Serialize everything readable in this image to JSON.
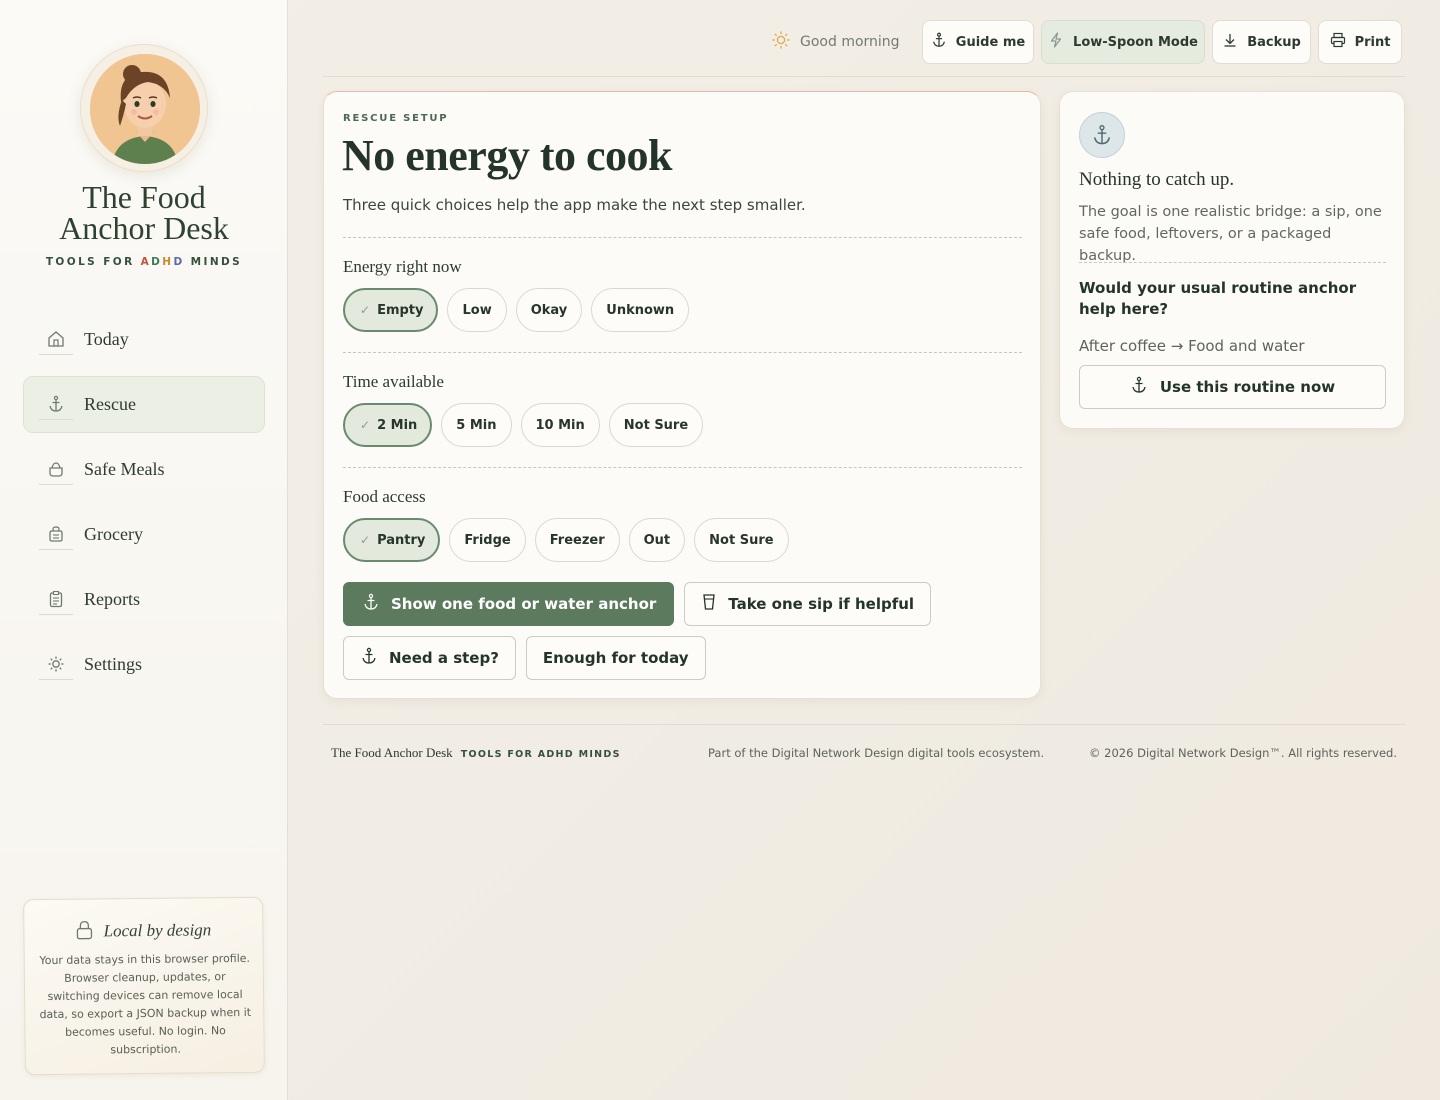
{
  "brand": {
    "title_line1": "The Food",
    "title_line2": "Anchor Desk",
    "tagline_pre": "TOOLS FOR ",
    "tagline_a": "A",
    "tagline_d1": "D",
    "tagline_h": "H",
    "tagline_d2": "D",
    "tagline_post": " MINDS"
  },
  "sidebar": {
    "items": [
      {
        "label": "Today",
        "icon": "home-icon"
      },
      {
        "label": "Rescue",
        "icon": "anchor-icon",
        "active": true
      },
      {
        "label": "Safe Meals",
        "icon": "bowl-icon"
      },
      {
        "label": "Grocery",
        "icon": "basket-icon"
      },
      {
        "label": "Reports",
        "icon": "clipboard-icon"
      },
      {
        "label": "Settings",
        "icon": "gear-icon"
      }
    ],
    "local_card": {
      "title": "Local by design",
      "body": "Your data stays in this browser profile. Browser cleanup, updates, or switching devices can remove local data, so export a JSON backup when it becomes useful. No login. No subscription."
    }
  },
  "topbar": {
    "greeting": "Good morning",
    "guide": "Guide me",
    "low_spoon": "Low-Spoon Mode",
    "backup": "Backup",
    "print": "Print"
  },
  "rescue": {
    "eyebrow": "RESCUE SETUP",
    "title": "No energy to cook",
    "subtitle": "Three quick choices help the app make the next step smaller.",
    "energy": {
      "label": "Energy right now",
      "options": [
        "Empty",
        "Low",
        "Okay",
        "Unknown"
      ],
      "selected": "Empty"
    },
    "time": {
      "label": "Time available",
      "options": [
        "2 Min",
        "5 Min",
        "10 Min",
        "Not Sure"
      ],
      "selected": "2 Min"
    },
    "food": {
      "label": "Food access",
      "options": [
        "Pantry",
        "Fridge",
        "Freezer",
        "Out",
        "Not Sure"
      ],
      "selected": "Pantry"
    },
    "actions": {
      "primary": "Show one food or water anchor",
      "sip": "Take one sip if helpful",
      "step": "Need a step?",
      "enough": "Enough for today"
    }
  },
  "catchup": {
    "title": "Nothing to catch up.",
    "text": "The goal is one realistic bridge: a sip, one safe food, leftovers, or a packaged backup.",
    "question": "Would your usual routine anchor help here?",
    "routine": "After coffee → Food and water",
    "button": "Use this routine now"
  },
  "footer": {
    "name": "The Food Anchor Desk",
    "tag": "TOOLS FOR ADHD MINDS",
    "ecosystem": "Part of the Digital Network Design digital tools ecosystem.",
    "copyright": "© 2026 Digital Network Design™. All rights reserved."
  },
  "colors": {
    "accent": "#5b7a5e",
    "selected_chip": "#e3e9dd",
    "background": "#f3efe7"
  }
}
